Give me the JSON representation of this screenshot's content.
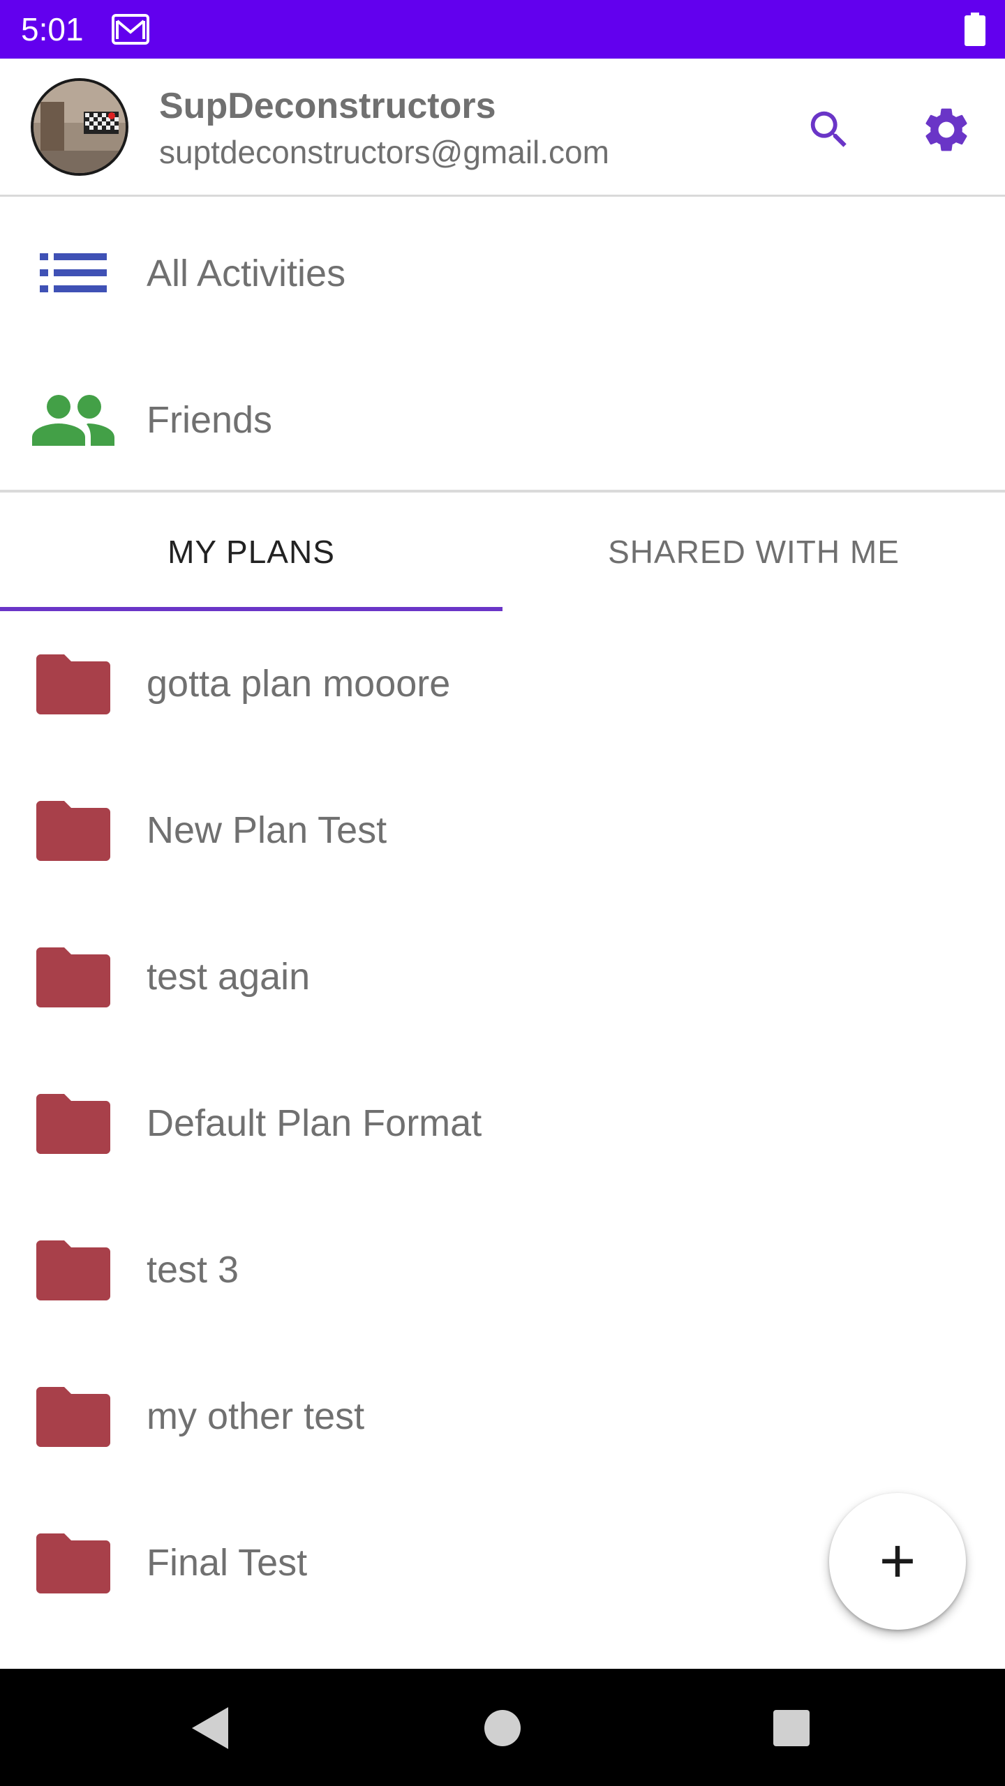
{
  "status_bar": {
    "time": "5:01",
    "background": "#6200ee"
  },
  "header": {
    "user_name": "SupDeconstructors",
    "user_email": "suptdeconstructors@gmail.com",
    "accent": "#6a35c7"
  },
  "nav": {
    "items": [
      {
        "label": "All Activities",
        "icon": "list-icon",
        "color": "#3f51b5"
      },
      {
        "label": "Friends",
        "icon": "people-icon",
        "color": "#43a047"
      }
    ]
  },
  "tabs": {
    "items": [
      {
        "label": "MY PLANS",
        "selected": true
      },
      {
        "label": "SHARED WITH ME",
        "selected": false
      }
    ]
  },
  "plans": {
    "folder_color": "#a8404a",
    "items": [
      {
        "label": "gotta plan mooore"
      },
      {
        "label": "New Plan Test"
      },
      {
        "label": "test again"
      },
      {
        "label": "Default Plan Format"
      },
      {
        "label": "test 3"
      },
      {
        "label": "my other test"
      },
      {
        "label": "Final Test"
      }
    ]
  },
  "fab": {
    "label": "+"
  }
}
